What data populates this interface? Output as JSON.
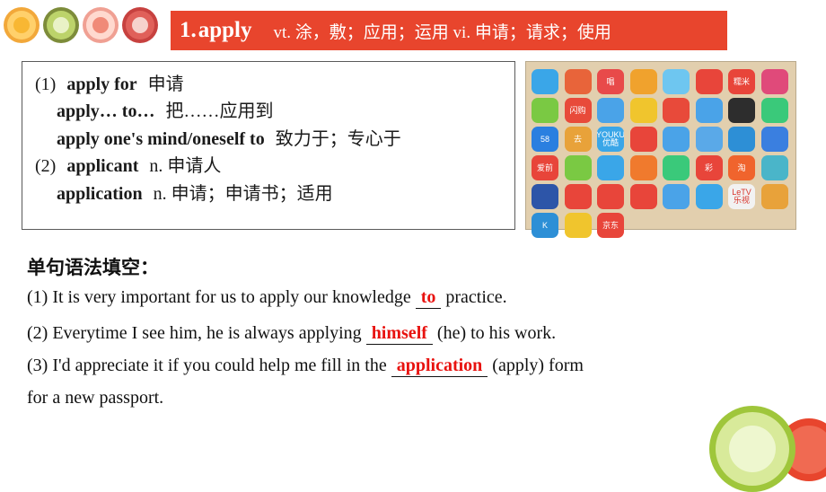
{
  "header": {
    "number": "1.",
    "word": "apply",
    "definition": "vt. 涂，敷；应用；运用  vi. 申请；请求；使用",
    "accent_color": "#e8452d"
  },
  "decorations": {
    "top_fruits": [
      "orange-slice",
      "kiwi-slice",
      "grapefruit-slice",
      "watermelon-slice"
    ],
    "bottom_fruits": [
      "lime-slice",
      "cherry-slice"
    ]
  },
  "notes_box": {
    "lines": [
      {
        "label": "(1)",
        "term": "apply for",
        "meaning": "申请",
        "indent": false
      },
      {
        "label": "",
        "term": "apply… to…",
        "meaning": "把……应用到",
        "indent": true
      },
      {
        "label": "",
        "term": "apply one's mind/oneself to",
        "meaning": "致力于；专心于",
        "indent": true
      },
      {
        "label": "(2)",
        "term": "applicant",
        "meaning": "n. 申请人",
        "indent": false
      },
      {
        "label": "",
        "term": "application",
        "meaning": "n. 申请；申请书；适用",
        "indent": true
      }
    ]
  },
  "icon_panel": {
    "name": "phone-app-grid-image",
    "icons": [
      {
        "label": "",
        "color": "#3aa6e8",
        "name": "telegram-icon"
      },
      {
        "label": "",
        "color": "#e8643a",
        "name": "tools-icon"
      },
      {
        "label": "唱",
        "color": "#e84a4a",
        "name": "changba-icon"
      },
      {
        "label": "",
        "color": "#f0a22d",
        "name": "calendar-icon"
      },
      {
        "label": "",
        "color": "#6ec6f0",
        "name": "bluetooth-icon"
      },
      {
        "label": "",
        "color": "#e8453a",
        "name": "video-icon"
      },
      {
        "label": "糯米",
        "color": "#e8453a",
        "name": "nuomi-icon"
      },
      {
        "label": "",
        "color": "#e04a7a",
        "name": "heart-chat-icon"
      },
      {
        "label": "",
        "color": "#7ac943",
        "name": "green-app-icon"
      },
      {
        "label": "闪购",
        "color": "#e84a3a",
        "name": "flash-buy-icon"
      },
      {
        "label": "",
        "color": "#4aa3e8",
        "name": "gallery-icon"
      },
      {
        "label": "",
        "color": "#f0c52d",
        "name": "mail-icon"
      },
      {
        "label": "",
        "color": "#e84a3a",
        "name": "music-icon"
      },
      {
        "label": "",
        "color": "#4aa3e8",
        "name": "browser-icon"
      },
      {
        "label": "",
        "color": "#2d2d2d",
        "name": "penguin-icon"
      },
      {
        "label": "",
        "color": "#3ac97a",
        "name": "wechat-icon"
      },
      {
        "label": "58",
        "color": "#2a7fe0",
        "name": "58tongcheng-icon"
      },
      {
        "label": "去",
        "color": "#e8a23a",
        "name": "qunar-icon"
      },
      {
        "label": "YOUKU 优酷",
        "color": "#3aa6e8",
        "name": "youku-icon"
      },
      {
        "label": "",
        "color": "#e8453a",
        "name": "player-icon"
      },
      {
        "label": "",
        "color": "#4aa3e8",
        "name": "cloud-icon"
      },
      {
        "label": "",
        "color": "#5aa9e8",
        "name": "twitter-icon"
      },
      {
        "label": "",
        "color": "#2d8fd6",
        "name": "arrow-icon"
      },
      {
        "label": "",
        "color": "#3a7fe0",
        "name": "blue-app-icon"
      },
      {
        "label": "爱前",
        "color": "#e8453a",
        "name": "iqiyi-icon"
      },
      {
        "label": "",
        "color": "#7ac943",
        "name": "green-leaf-icon"
      },
      {
        "label": "",
        "color": "#3aa6e8",
        "name": "eye-icon"
      },
      {
        "label": "",
        "color": "#f07a2d",
        "name": "clock-icon"
      },
      {
        "label": "",
        "color": "#3ac97a",
        "name": "play-icon"
      },
      {
        "label": "彩",
        "color": "#e8453a",
        "name": "lottery-icon"
      },
      {
        "label": "淘",
        "color": "#f0642d",
        "name": "taobao-icon"
      },
      {
        "label": "",
        "color": "#4ab5c9",
        "name": "map-icon"
      },
      {
        "label": "",
        "color": "#2d55a8",
        "name": "dark-blue-app-icon"
      },
      {
        "label": "",
        "color": "#e8453a",
        "name": "red-flower-icon"
      },
      {
        "label": "",
        "color": "#e8453a",
        "name": "meituan-icon"
      },
      {
        "label": "",
        "color": "#e8453a",
        "name": "movie-icon"
      },
      {
        "label": "",
        "color": "#4aa3e8",
        "name": "light-blue-app-icon"
      },
      {
        "label": "",
        "color": "#3aa6e8",
        "name": "camera-icon"
      },
      {
        "label": "LeTV 乐视",
        "color": "#f2f2f2",
        "name": "letv-icon"
      },
      {
        "label": "",
        "color": "#e8a23a",
        "name": "orange-app-icon"
      },
      {
        "label": "K",
        "color": "#2d8fd6",
        "name": "kugou-icon"
      },
      {
        "label": "",
        "color": "#f0c52d",
        "name": "star-icon"
      },
      {
        "label": "京东",
        "color": "#e8453a",
        "name": "jingdong-icon"
      }
    ]
  },
  "exercise": {
    "title": "单句语法填空：",
    "items": [
      {
        "label": "(1)",
        "before": "It is very important for us to apply our knowledge",
        "answer": "to",
        "after": "practice.",
        "hint": ""
      },
      {
        "label": "(2)",
        "before": "Everytime I see him, he is always applying",
        "answer": "himself",
        "after": "(he) to his work.",
        "hint": ""
      },
      {
        "label": "(3)",
        "before": "I'd appreciate it if you could help me fill in the",
        "answer": "application",
        "after": "(apply) form",
        "hint": "for a new passport."
      }
    ],
    "answer_color": "#e8120f"
  }
}
